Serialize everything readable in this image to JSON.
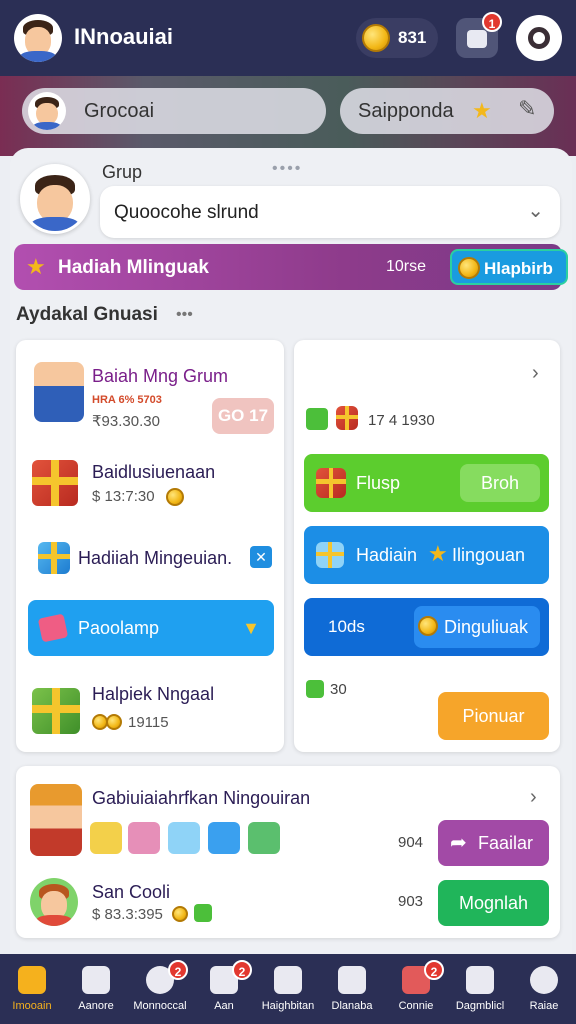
{
  "topbar": {
    "title": "INnoauiai",
    "coins": "831",
    "bag_badge": "1"
  },
  "banner": {
    "left_pill_label": "Grocoai",
    "right_pill_label": "Saipponda"
  },
  "drag_handle": "••••",
  "group": {
    "label": "Grup",
    "select_value": "Quoocohe slrund"
  },
  "weekly_reward": {
    "title": "Hadiah Mlinguak",
    "count": "10rse",
    "claim_label": "Hlapbirb"
  },
  "section": {
    "title": "Aydakal Gnuasi",
    "more": "•••"
  },
  "left_card": {
    "rows": [
      {
        "title": "Baiah Mng Grum",
        "reward": "HRA  6%  5703",
        "sub": "₹93.30.30",
        "button": "GO 17"
      },
      {
        "title": "Baidlusiuenaan",
        "sub": "$ 13:7:30"
      },
      {
        "title": "Hadiiah Mingeuian."
      },
      {
        "title": "Halpiek Nngaal",
        "sub": "19115"
      }
    ],
    "wide_button": "Paoolamp"
  },
  "right_card": {
    "top_value": "17 4 1930",
    "green_button": "Flusp",
    "green_inner": "Broh",
    "blue_button": "Hadiain",
    "blue_button_2": "Ilingouan",
    "blue3_left": "10ds",
    "blue3_inner": "Dinguliuak",
    "small_value": "30",
    "orange_button": "Pionuar"
  },
  "bottom_card": {
    "title": "Gabiuiaiahrfkan Ningouiran",
    "row1_value": "904",
    "purple_button": "Faailar",
    "row2_title": "San Cooli",
    "row2_sub": "$ 83.3:395",
    "row2_value": "903",
    "green_button": "Mognlah"
  },
  "nav": {
    "items": [
      {
        "label": "Imooain",
        "active": true
      },
      {
        "label": "Aanore"
      },
      {
        "label": "Monnoccal",
        "badge": "2"
      },
      {
        "label": "Aan",
        "badge": "2"
      },
      {
        "label": "Haighbitan"
      },
      {
        "label": "Dlanaba"
      },
      {
        "label": "Connie",
        "badge": "2"
      },
      {
        "label": "Dagmblicl"
      },
      {
        "label": "Raiae"
      }
    ]
  },
  "colors": {
    "topbar": "#2b2f55",
    "accent_purple": "#a24aa6",
    "accent_blue": "#1c8ee6",
    "accent_green": "#5ccd2e",
    "accent_orange": "#f6a52a"
  }
}
